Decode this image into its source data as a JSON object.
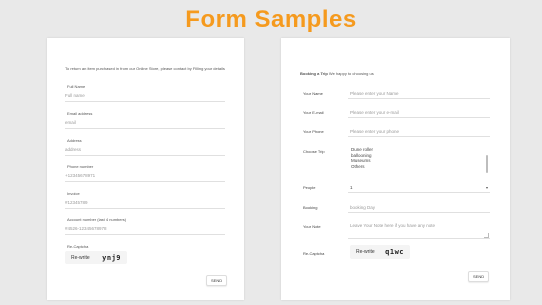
{
  "page_title": "Form Samples",
  "left_form": {
    "intro": "To return an item purchased in from our Online Store, please contact by Filling your details",
    "fields": [
      {
        "label": "Full Name",
        "value": "Full name"
      },
      {
        "label": "Email address",
        "value": "email"
      },
      {
        "label": "Address",
        "value": "address"
      },
      {
        "label": "Phone number",
        "value": "+12345678971"
      },
      {
        "label": "Invoice",
        "value": "#12345789"
      },
      {
        "label": "Account number (last 4 numbers)",
        "value": "#4526-12345678978"
      }
    ],
    "captcha": {
      "label": "Re-Captcha",
      "rewrite": "Re-write",
      "code": "ynj9"
    },
    "send": "SEND"
  },
  "right_form": {
    "intro_bold": "Booking a Trip",
    "intro_rest": " We happy to choosing us",
    "name": {
      "label": "Your Name",
      "placeholder": "Please enter your Name"
    },
    "email": {
      "label": "Your E-mail",
      "placeholder": "Please enter your e-mail"
    },
    "phone": {
      "label": "Your Phone",
      "placeholder": "Please enter your phone"
    },
    "trip": {
      "label": "Choose Trip",
      "options": [
        "Dune roller",
        "ballooning",
        "Museums",
        "Others"
      ]
    },
    "people": {
      "label": "People",
      "value": "1"
    },
    "booking": {
      "label": "Booking",
      "placeholder": "booking Day"
    },
    "note": {
      "label": "Your Note",
      "placeholder": "Leave Your Note here if you have any note"
    },
    "captcha": {
      "label": "Re-Captcha",
      "rewrite": "Re-write",
      "code": "q1wc"
    },
    "send": "SEND"
  }
}
